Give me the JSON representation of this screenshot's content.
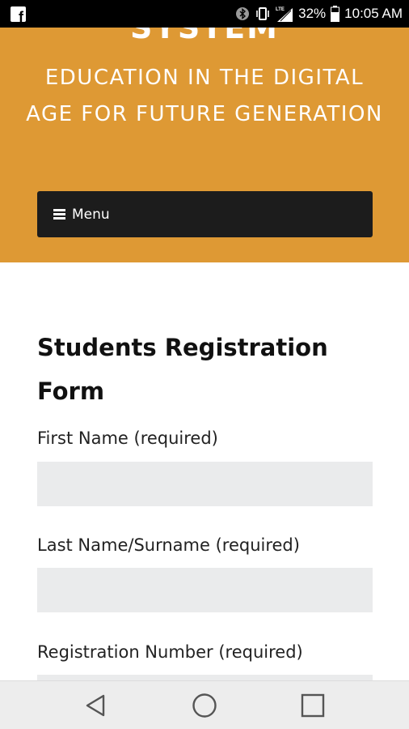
{
  "status_bar": {
    "app_icon": "facebook-icon",
    "network": "LTE",
    "battery": "32%",
    "time": "10:05 AM"
  },
  "header": {
    "site_title": "SYSTEM",
    "tagline": "EDUCATION IN THE DIGITAL AGE FOR FUTURE GENERATION",
    "menu_label": "Menu",
    "background_color": "#DE9934"
  },
  "form": {
    "title": "Students Registration Form",
    "fields": [
      {
        "label": "First Name (required)",
        "value": ""
      },
      {
        "label": "Last Name/Surname (required)",
        "value": ""
      },
      {
        "label": "Registration Number (required)",
        "value": ""
      }
    ]
  },
  "nav_bar": {
    "back": "back-icon",
    "home": "home-icon",
    "recents": "recents-icon"
  }
}
